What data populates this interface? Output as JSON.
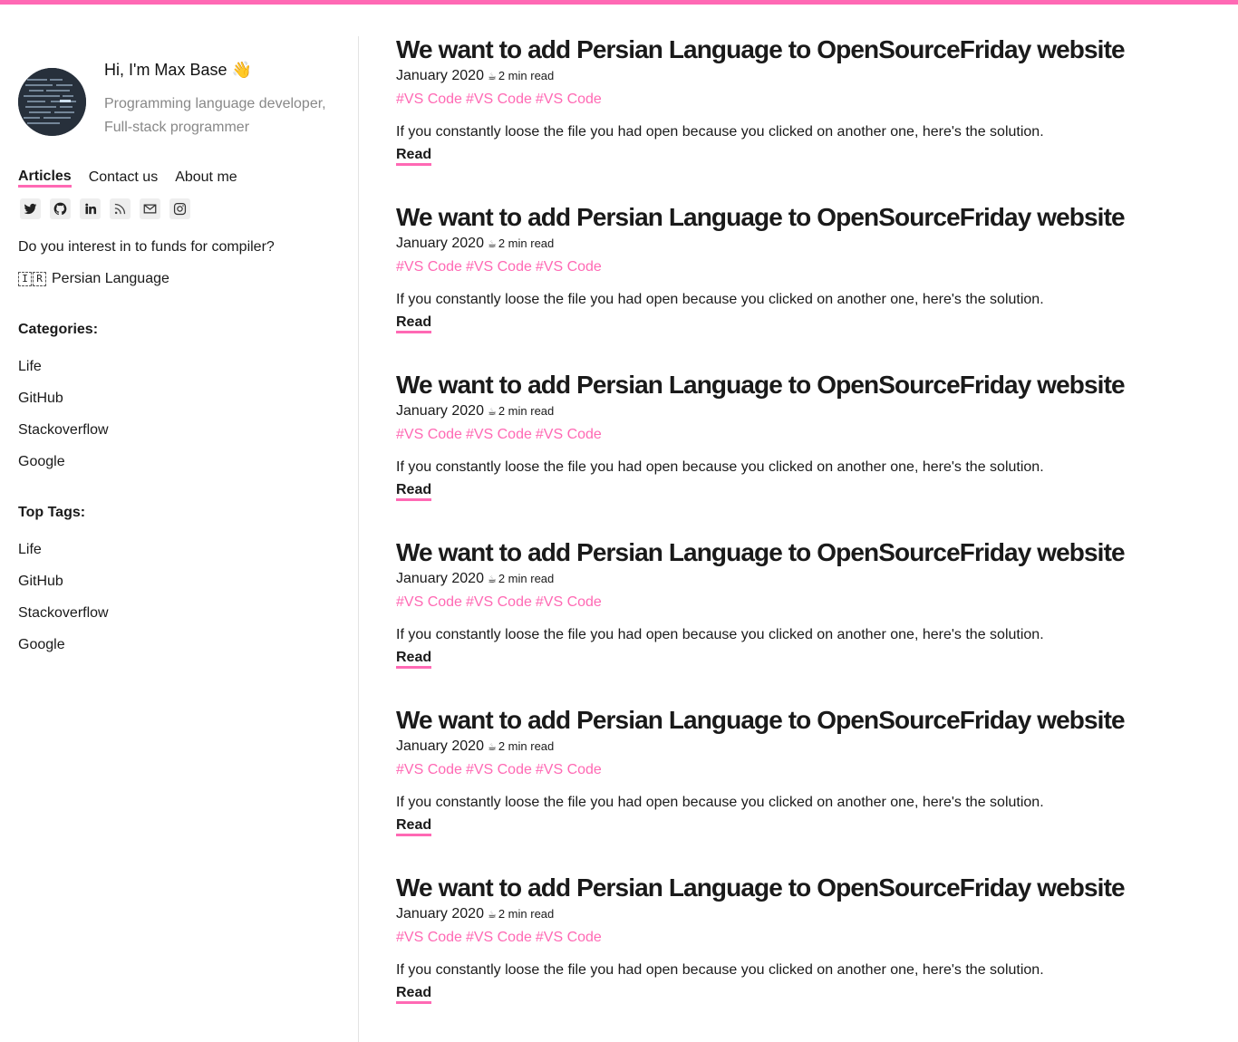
{
  "accent_color": "#ff69b4",
  "profile": {
    "greeting": "Hi, I'm Max Base",
    "wave_emoji": "👋",
    "bio": "Programming language developer, Full-stack programmer"
  },
  "nav": [
    {
      "label": "Articles",
      "active": true
    },
    {
      "label": "Contact us",
      "active": false
    },
    {
      "label": "About me",
      "active": false
    }
  ],
  "socials": [
    "twitter-icon",
    "github-icon",
    "linkedin-icon",
    "rss-icon",
    "mail-icon",
    "instagram-icon"
  ],
  "fund_question": "Do you interest in to funds for compiler?",
  "language": {
    "flag_letters": [
      "I",
      "R"
    ],
    "label": "Persian Language"
  },
  "categories": {
    "title": "Categories:",
    "items": [
      "Life",
      "GitHub",
      "Stackoverflow",
      "Google"
    ]
  },
  "top_tags": {
    "title": "Top Tags:",
    "items": [
      "Life",
      "GitHub",
      "Stackoverflow",
      "Google"
    ]
  },
  "posts": [
    {
      "title": "We want to add Persian Language to OpenSourceFriday website",
      "date": "January 2020",
      "read_time": "2 min read",
      "tags": [
        "#VS Code",
        "#VS Code",
        "#VS Code"
      ],
      "excerpt": "If you constantly loose the file you had open because you clicked on another one, here's the solution.",
      "read_label": "Read"
    },
    {
      "title": "We want to add Persian Language to OpenSourceFriday website",
      "date": "January 2020",
      "read_time": "2 min read",
      "tags": [
        "#VS Code",
        "#VS Code",
        "#VS Code"
      ],
      "excerpt": "If you constantly loose the file you had open because you clicked on another one, here's the solution.",
      "read_label": "Read"
    },
    {
      "title": "We want to add Persian Language to OpenSourceFriday website",
      "date": "January 2020",
      "read_time": "2 min read",
      "tags": [
        "#VS Code",
        "#VS Code",
        "#VS Code"
      ],
      "excerpt": "If you constantly loose the file you had open because you clicked on another one, here's the solution.",
      "read_label": "Read"
    },
    {
      "title": "We want to add Persian Language to OpenSourceFriday website",
      "date": "January 2020",
      "read_time": "2 min read",
      "tags": [
        "#VS Code",
        "#VS Code",
        "#VS Code"
      ],
      "excerpt": "If you constantly loose the file you had open because you clicked on another one, here's the solution.",
      "read_label": "Read"
    },
    {
      "title": "We want to add Persian Language to OpenSourceFriday website",
      "date": "January 2020",
      "read_time": "2 min read",
      "tags": [
        "#VS Code",
        "#VS Code",
        "#VS Code"
      ],
      "excerpt": "If you constantly loose the file you had open because you clicked on another one, here's the solution.",
      "read_label": "Read"
    },
    {
      "title": "We want to add Persian Language to OpenSourceFriday website",
      "date": "January 2020",
      "read_time": "2 min read",
      "tags": [
        "#VS Code",
        "#VS Code",
        "#VS Code"
      ],
      "excerpt": "If you constantly loose the file you had open because you clicked on another one, here's the solution.",
      "read_label": "Read"
    }
  ]
}
